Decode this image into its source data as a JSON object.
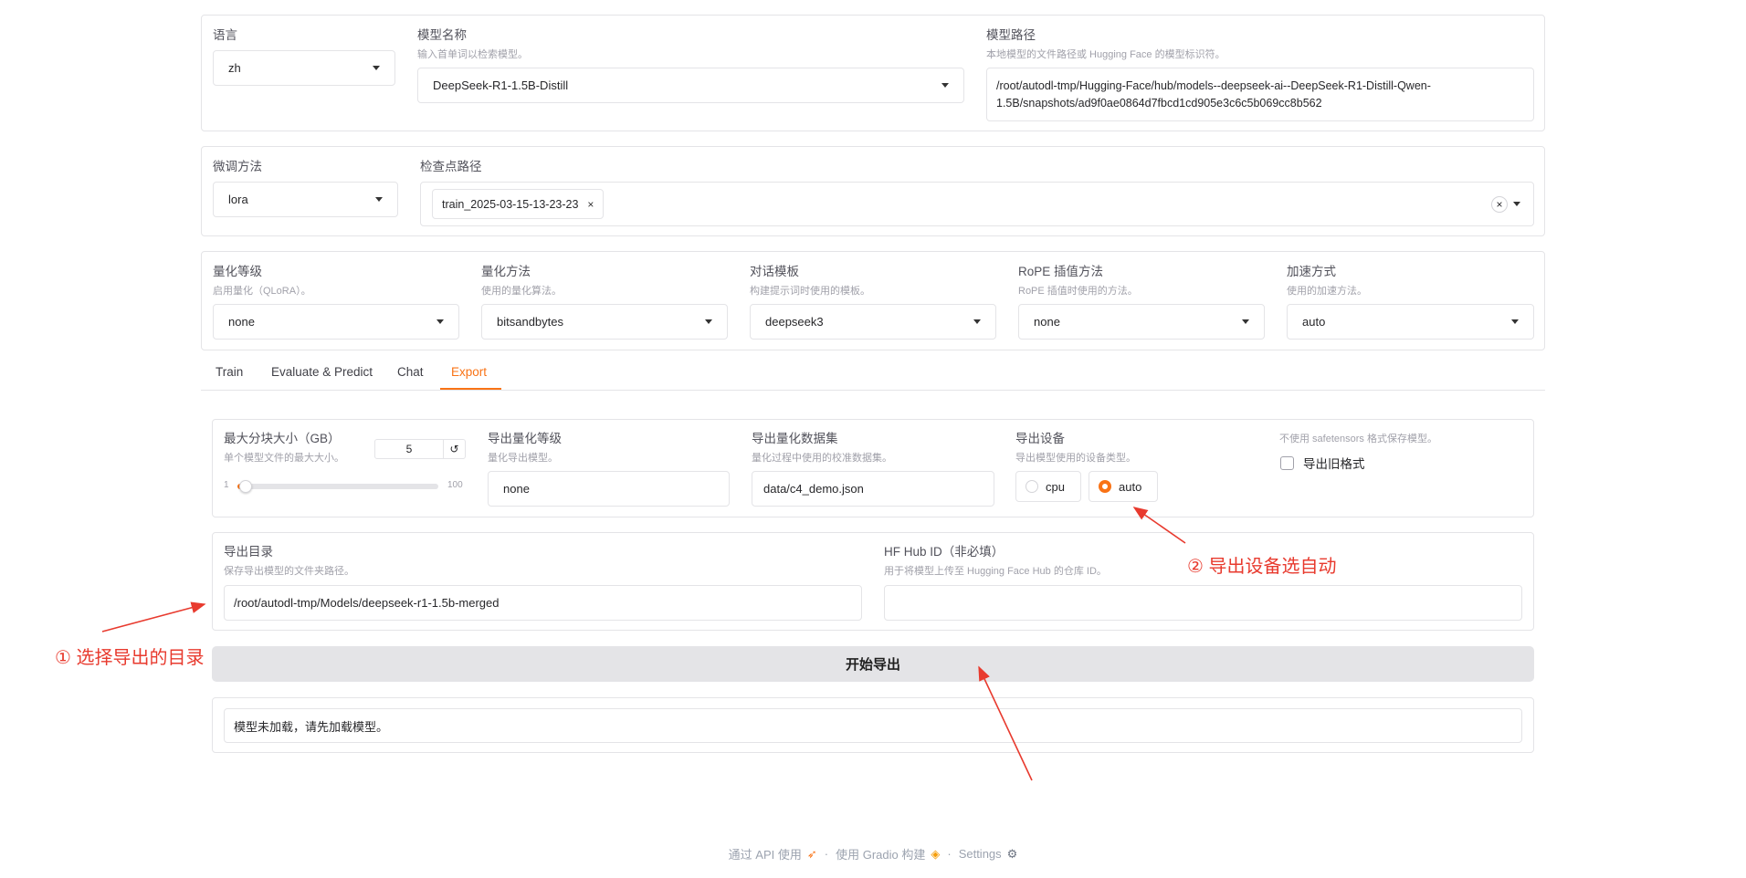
{
  "top": {
    "language": {
      "label": "语言",
      "value": "zh"
    },
    "model_name": {
      "label": "模型名称",
      "info": "输入首单词以检索模型。",
      "value": "DeepSeek-R1-1.5B-Distill"
    },
    "model_path": {
      "label": "模型路径",
      "info": "本地模型的文件路径或 Hugging Face 的模型标识符。",
      "line1": "/root/autodl-tmp/Hugging-Face/hub/models--deepseek-ai--DeepSeek-R1-Distill-Qwen-",
      "line2": "1.5B/snapshots/ad9f0ae0864d7fbcd1cd905e3c6c5b069cc8b562"
    }
  },
  "second": {
    "finetune": {
      "label": "微调方法",
      "value": "lora"
    },
    "checkpoint": {
      "label": "检查点路径",
      "chip": "train_2025-03-15-13-23-23",
      "chip_close": "×",
      "clear": "×"
    }
  },
  "third": {
    "quant_bit": {
      "label": "量化等级",
      "info": "启用量化（QLoRA）。",
      "value": "none"
    },
    "quant_method": {
      "label": "量化方法",
      "info": "使用的量化算法。",
      "value": "bitsandbytes"
    },
    "template": {
      "label": "对话模板",
      "info": "构建提示词时使用的模板。",
      "value": "deepseek3"
    },
    "rope": {
      "label": "RoPE 插值方法",
      "info": "RoPE 插值时使用的方法。",
      "value": "none"
    },
    "booster": {
      "label": "加速方式",
      "info": "使用的加速方法。",
      "value": "auto"
    }
  },
  "tabs": [
    "Train",
    "Evaluate & Predict",
    "Chat",
    "Export"
  ],
  "active_tab": "Export",
  "export": {
    "shard": {
      "label": "最大分块大小（GB）",
      "info": "单个模型文件的最大大小。",
      "value": "5",
      "reset": "↺",
      "min": "1",
      "max": "100",
      "slider_value": 5
    },
    "quant_bit": {
      "label": "导出量化等级",
      "info": "量化导出模型。",
      "value": "none"
    },
    "quant_dataset": {
      "label": "导出量化数据集",
      "info": "量化过程中使用的校准数据集。",
      "value": "data/c4_demo.json"
    },
    "device": {
      "label": "导出设备",
      "info": "导出模型使用的设备类型。",
      "options": [
        "cpu",
        "auto"
      ],
      "selected": "auto"
    },
    "legacy": {
      "info": "不使用 safetensors 格式保存模型。",
      "label": "导出旧格式",
      "checked": false
    },
    "dir": {
      "label": "导出目录",
      "info": "保存导出模型的文件夹路径。",
      "value": "/root/autodl-tmp/Models/deepseek-r1-1.5b-merged"
    },
    "hub": {
      "label": "HF Hub ID（非必填）",
      "info": "用于将模型上传至 Hugging Face Hub 的仓库 ID。",
      "value": ""
    },
    "button": "开始导出",
    "output": "模型未加载，请先加载模型。"
  },
  "annotations": {
    "a1": "① 选择导出的目录",
    "a2": "② 导出设备选自动"
  },
  "footer": {
    "api": "通过 API 使用",
    "sep": "·",
    "gradio": "使用 Gradio 构建",
    "settings": "Settings"
  },
  "colors": {
    "accent": "#f97316",
    "annotation": "#e83a2e",
    "button_bg": "#e4e4e7"
  }
}
